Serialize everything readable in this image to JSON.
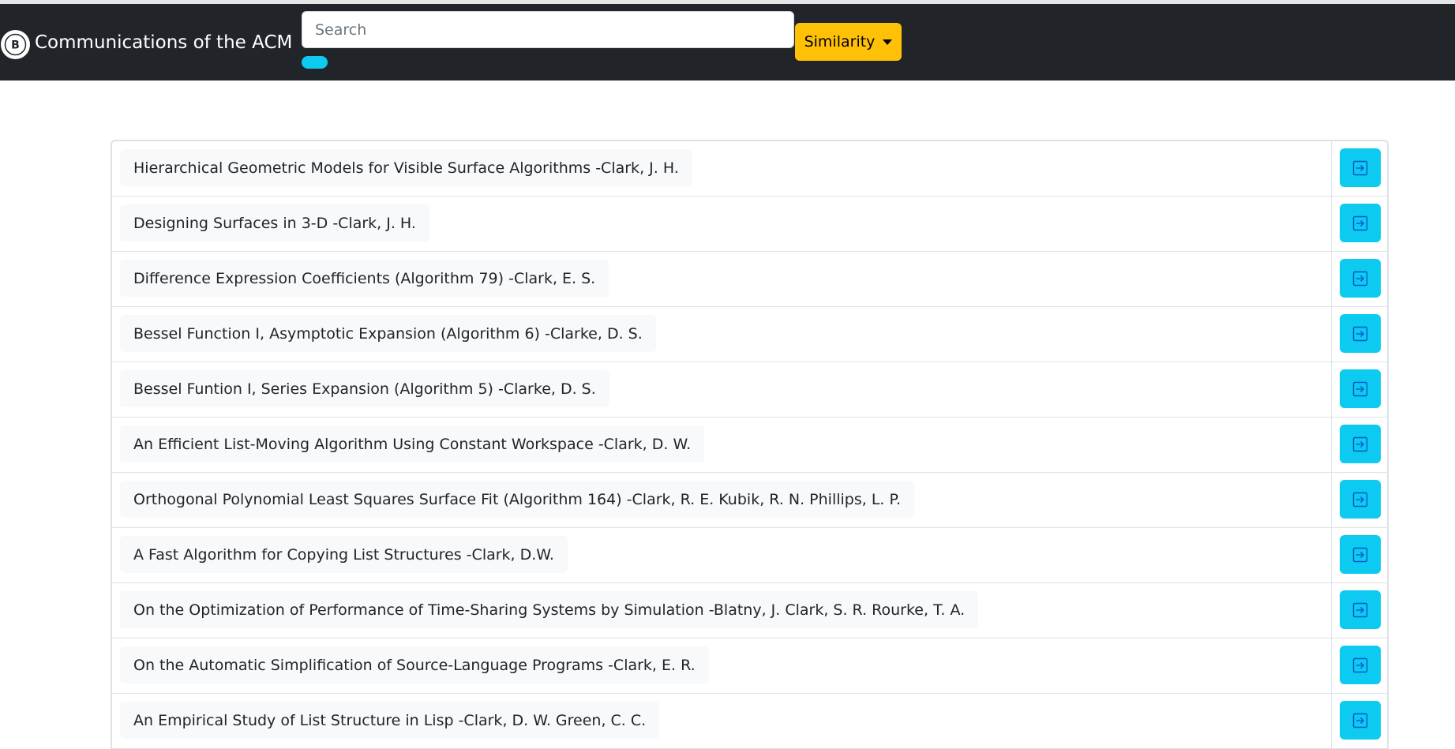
{
  "header": {
    "logo_letter": "B",
    "title": "Communications of the ACM",
    "search_placeholder": "Search",
    "search_value": "",
    "sort_label": "Similarity"
  },
  "colors": {
    "navbar": "#212529",
    "accent_info": "#0dcaf0",
    "accent_warning": "#ffc107",
    "chip_background": "#f8f9fa"
  },
  "icons": {
    "row_action": "box-arrow-in-right-icon",
    "sort_dropdown": "caret-down-icon"
  },
  "results": [
    {
      "title": "Hierarchical Geometric Models for Visible Surface Algorithms -Clark, J. H."
    },
    {
      "title": "Designing Surfaces in 3-D -Clark, J. H."
    },
    {
      "title": "Difference Expression Coefficients (Algorithm 79) -Clark, E. S."
    },
    {
      "title": "Bessel Function I, Asymptotic Expansion (Algorithm 6) -Clarke, D. S."
    },
    {
      "title": "Bessel Funtion I, Series Expansion (Algorithm 5) -Clarke, D. S."
    },
    {
      "title": "An Efficient List-Moving Algorithm Using Constant Workspace -Clark, D. W."
    },
    {
      "title": "Orthogonal Polynomial Least Squares Surface Fit (Algorithm 164) -Clark, R. E. Kubik, R. N. Phillips, L. P."
    },
    {
      "title": "A Fast Algorithm for Copying List Structures -Clark, D.W."
    },
    {
      "title": "On the Optimization of Performance of Time-Sharing Systems by Simulation -Blatny, J. Clark, S. R. Rourke, T. A."
    },
    {
      "title": "On the Automatic Simplification of Source-Language Programs -Clark, E. R."
    },
    {
      "title": "An Empirical Study of List Structure in Lisp -Clark, D. W. Green, C. C."
    }
  ]
}
